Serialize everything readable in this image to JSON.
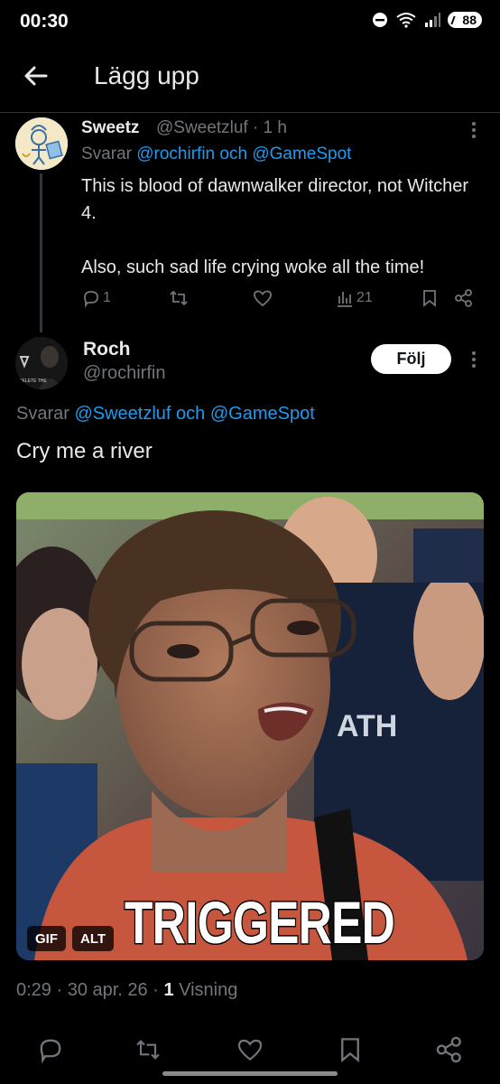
{
  "status_bar": {
    "time": "00:30",
    "battery": "88"
  },
  "header": {
    "title": "Lägg upp"
  },
  "parent_tweet": {
    "name": "Sweetz",
    "handle_time": "@Sweetzluf · 1 h",
    "reply_prefix": "Svarar",
    "reply_to_1": "@rochirfin",
    "reply_and": "och",
    "reply_to_2": "@GameSpot",
    "body_1": "This is blood of dawnwalker director, not Witcher 4.",
    "body_2": "Also, such sad life crying woke all the time!",
    "replies": "1",
    "views": "21"
  },
  "main_tweet": {
    "name": "Roch",
    "handle": "@rochirfin",
    "avatar_text": "DELETE THE",
    "follow_label": "Följ",
    "reply_prefix": "Svarar",
    "reply_to_1": "@Sweetzluf",
    "reply_and": "och",
    "reply_to_2": "@GameSpot",
    "text": "Cry me a river",
    "media": {
      "caption": "TRIGGERED",
      "gif_badge": "GIF",
      "alt_badge": "ALT"
    },
    "meta_time": "0:29 · 30 apr. 26 · ",
    "meta_views_count": "1",
    "meta_views_label": " Visning"
  },
  "icons": [
    "back-arrow-icon",
    "more-icon",
    "reply-icon",
    "retweet-icon",
    "like-icon",
    "views-icon",
    "bookmark-icon",
    "share-icon"
  ],
  "colors": {
    "background": "#000000",
    "text": "#e7e9ea",
    "muted": "#71767b",
    "link": "#1d9bf0"
  }
}
